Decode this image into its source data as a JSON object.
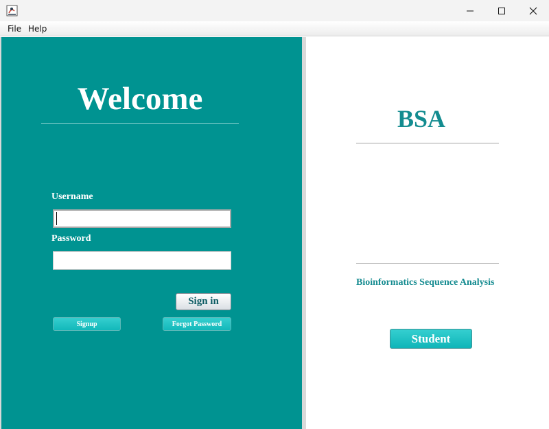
{
  "window": {
    "app_icon": "java-app-icon",
    "controls": {
      "minimize": "minimize-icon",
      "maximize": "maximize-icon",
      "close": "close-icon"
    }
  },
  "menu": {
    "file": "File",
    "help": "Help"
  },
  "login": {
    "title": "Welcome",
    "username_label": "Username",
    "username_value": "",
    "password_label": "Password",
    "password_value": "",
    "signin_label": "Sign in",
    "signup_label": "Signup",
    "forgot_label": "Forgot Password"
  },
  "info": {
    "title": "BSA",
    "subtitle": "Bioinformatics Sequence Analysis",
    "student_label": "Student"
  },
  "colors": {
    "panel_teal": "#009391",
    "button_teal": "#12b8ba",
    "heading_teal": "#138c90"
  }
}
